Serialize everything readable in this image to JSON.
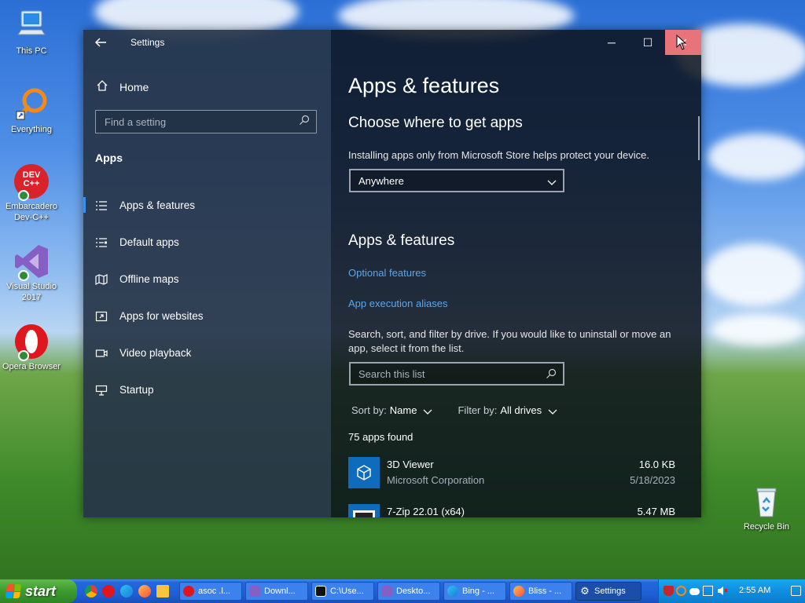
{
  "desktop": {
    "icons": [
      {
        "label": "This PC"
      },
      {
        "label": "Everything"
      },
      {
        "label": "Embarcadero Dev-C++"
      },
      {
        "label": "Visual Studio 2017"
      },
      {
        "label": "Opera Browser"
      },
      {
        "label": "Recycle Bin"
      }
    ],
    "dev_icon_text": "DEV C++"
  },
  "window": {
    "title": "Settings",
    "controls": {
      "minimize": "─",
      "maximize": "☐",
      "close": "✕"
    }
  },
  "sidebar": {
    "home_label": "Home",
    "search_placeholder": "Find a setting",
    "section": "Apps",
    "items": [
      {
        "label": "Apps & features",
        "icon": "list-icon"
      },
      {
        "label": "Default apps",
        "icon": "default-apps-icon"
      },
      {
        "label": "Offline maps",
        "icon": "map-icon"
      },
      {
        "label": "Apps for websites",
        "icon": "open-external-icon"
      },
      {
        "label": "Video playback",
        "icon": "video-icon"
      },
      {
        "label": "Startup",
        "icon": "startup-icon"
      }
    ]
  },
  "main": {
    "title": "Apps & features",
    "choose_heading": "Choose where to get apps",
    "choose_desc": "Installing apps only from Microsoft Store helps protect your device.",
    "source_value": "Anywhere",
    "features_heading": "Apps & features",
    "link_optional": "Optional features",
    "link_aliases": "App execution aliases",
    "search_desc": "Search, sort, and filter by drive. If you would like to uninstall or move an app, select it from the list.",
    "list_search_placeholder": "Search this list",
    "sort_label": "Sort by:",
    "sort_value": "Name",
    "filter_label": "Filter by:",
    "filter_value": "All drives",
    "count": "75 apps found",
    "apps": [
      {
        "name": "3D Viewer",
        "publisher": "Microsoft Corporation",
        "size": "16.0 KB",
        "date": "5/18/2023"
      },
      {
        "name": "7-Zip 22.01 (x64)",
        "publisher": "",
        "size": "5.47 MB",
        "date": ""
      }
    ]
  },
  "taskbar": {
    "start_label": "start",
    "buttons": [
      {
        "label": "asoc .l..."
      },
      {
        "label": "Downl..."
      },
      {
        "label": "C:\\Use..."
      },
      {
        "label": "Deskto..."
      },
      {
        "label": "Bing - ..."
      },
      {
        "label": "Bliss - ..."
      },
      {
        "label": "Settings"
      }
    ],
    "clock": "2:55 AM"
  },
  "colors": {
    "accent": "#3b8eea",
    "link": "#5aa7ee",
    "close_hover": "#e8737a",
    "start_green": "#3c9a2e",
    "taskbar_blue": "#2467dc"
  }
}
